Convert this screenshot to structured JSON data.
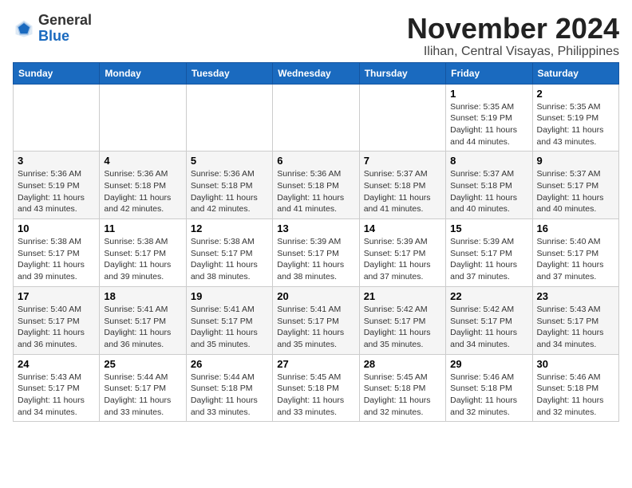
{
  "logo": {
    "general": "General",
    "blue": "Blue"
  },
  "header": {
    "month": "November 2024",
    "location": "Ilihan, Central Visayas, Philippines"
  },
  "weekdays": [
    "Sunday",
    "Monday",
    "Tuesday",
    "Wednesday",
    "Thursday",
    "Friday",
    "Saturday"
  ],
  "weeks": [
    [
      {
        "day": "",
        "info": ""
      },
      {
        "day": "",
        "info": ""
      },
      {
        "day": "",
        "info": ""
      },
      {
        "day": "",
        "info": ""
      },
      {
        "day": "",
        "info": ""
      },
      {
        "day": "1",
        "info": "Sunrise: 5:35 AM\nSunset: 5:19 PM\nDaylight: 11 hours and 44 minutes."
      },
      {
        "day": "2",
        "info": "Sunrise: 5:35 AM\nSunset: 5:19 PM\nDaylight: 11 hours and 43 minutes."
      }
    ],
    [
      {
        "day": "3",
        "info": "Sunrise: 5:36 AM\nSunset: 5:19 PM\nDaylight: 11 hours and 43 minutes."
      },
      {
        "day": "4",
        "info": "Sunrise: 5:36 AM\nSunset: 5:18 PM\nDaylight: 11 hours and 42 minutes."
      },
      {
        "day": "5",
        "info": "Sunrise: 5:36 AM\nSunset: 5:18 PM\nDaylight: 11 hours and 42 minutes."
      },
      {
        "day": "6",
        "info": "Sunrise: 5:36 AM\nSunset: 5:18 PM\nDaylight: 11 hours and 41 minutes."
      },
      {
        "day": "7",
        "info": "Sunrise: 5:37 AM\nSunset: 5:18 PM\nDaylight: 11 hours and 41 minutes."
      },
      {
        "day": "8",
        "info": "Sunrise: 5:37 AM\nSunset: 5:18 PM\nDaylight: 11 hours and 40 minutes."
      },
      {
        "day": "9",
        "info": "Sunrise: 5:37 AM\nSunset: 5:17 PM\nDaylight: 11 hours and 40 minutes."
      }
    ],
    [
      {
        "day": "10",
        "info": "Sunrise: 5:38 AM\nSunset: 5:17 PM\nDaylight: 11 hours and 39 minutes."
      },
      {
        "day": "11",
        "info": "Sunrise: 5:38 AM\nSunset: 5:17 PM\nDaylight: 11 hours and 39 minutes."
      },
      {
        "day": "12",
        "info": "Sunrise: 5:38 AM\nSunset: 5:17 PM\nDaylight: 11 hours and 38 minutes."
      },
      {
        "day": "13",
        "info": "Sunrise: 5:39 AM\nSunset: 5:17 PM\nDaylight: 11 hours and 38 minutes."
      },
      {
        "day": "14",
        "info": "Sunrise: 5:39 AM\nSunset: 5:17 PM\nDaylight: 11 hours and 37 minutes."
      },
      {
        "day": "15",
        "info": "Sunrise: 5:39 AM\nSunset: 5:17 PM\nDaylight: 11 hours and 37 minutes."
      },
      {
        "day": "16",
        "info": "Sunrise: 5:40 AM\nSunset: 5:17 PM\nDaylight: 11 hours and 37 minutes."
      }
    ],
    [
      {
        "day": "17",
        "info": "Sunrise: 5:40 AM\nSunset: 5:17 PM\nDaylight: 11 hours and 36 minutes."
      },
      {
        "day": "18",
        "info": "Sunrise: 5:41 AM\nSunset: 5:17 PM\nDaylight: 11 hours and 36 minutes."
      },
      {
        "day": "19",
        "info": "Sunrise: 5:41 AM\nSunset: 5:17 PM\nDaylight: 11 hours and 35 minutes."
      },
      {
        "day": "20",
        "info": "Sunrise: 5:41 AM\nSunset: 5:17 PM\nDaylight: 11 hours and 35 minutes."
      },
      {
        "day": "21",
        "info": "Sunrise: 5:42 AM\nSunset: 5:17 PM\nDaylight: 11 hours and 35 minutes."
      },
      {
        "day": "22",
        "info": "Sunrise: 5:42 AM\nSunset: 5:17 PM\nDaylight: 11 hours and 34 minutes."
      },
      {
        "day": "23",
        "info": "Sunrise: 5:43 AM\nSunset: 5:17 PM\nDaylight: 11 hours and 34 minutes."
      }
    ],
    [
      {
        "day": "24",
        "info": "Sunrise: 5:43 AM\nSunset: 5:17 PM\nDaylight: 11 hours and 34 minutes."
      },
      {
        "day": "25",
        "info": "Sunrise: 5:44 AM\nSunset: 5:17 PM\nDaylight: 11 hours and 33 minutes."
      },
      {
        "day": "26",
        "info": "Sunrise: 5:44 AM\nSunset: 5:18 PM\nDaylight: 11 hours and 33 minutes."
      },
      {
        "day": "27",
        "info": "Sunrise: 5:45 AM\nSunset: 5:18 PM\nDaylight: 11 hours and 33 minutes."
      },
      {
        "day": "28",
        "info": "Sunrise: 5:45 AM\nSunset: 5:18 PM\nDaylight: 11 hours and 32 minutes."
      },
      {
        "day": "29",
        "info": "Sunrise: 5:46 AM\nSunset: 5:18 PM\nDaylight: 11 hours and 32 minutes."
      },
      {
        "day": "30",
        "info": "Sunrise: 5:46 AM\nSunset: 5:18 PM\nDaylight: 11 hours and 32 minutes."
      }
    ]
  ]
}
